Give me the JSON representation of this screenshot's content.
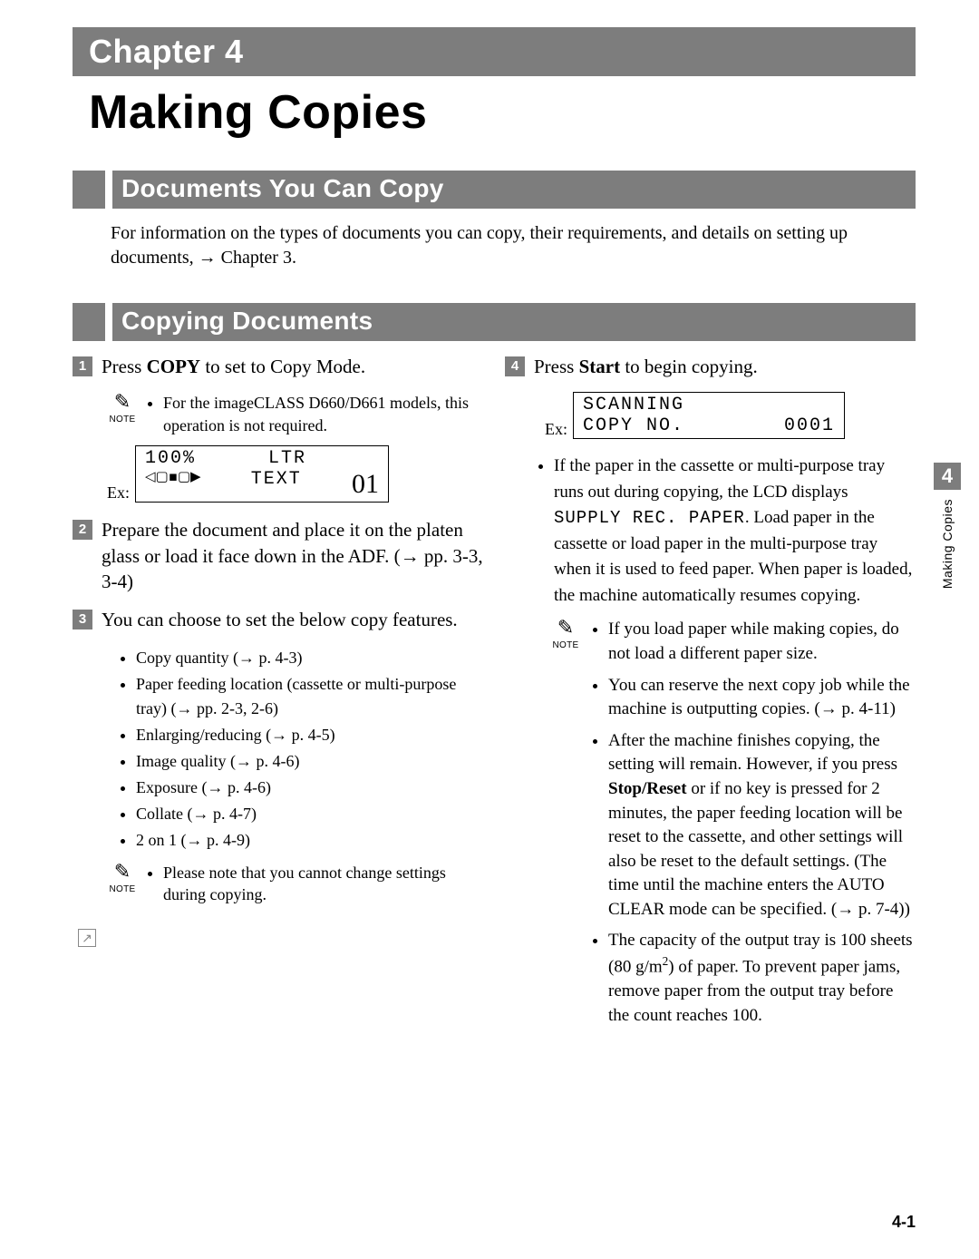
{
  "chapter": {
    "bar": "Chapter 4",
    "title": "Making Copies"
  },
  "section1": {
    "title": "Documents You Can Copy",
    "intro": "For information on the types of documents you can copy, their requirements, and details on setting up documents, → Chapter 3."
  },
  "section2": {
    "title": "Copying Documents"
  },
  "steps": {
    "s1": {
      "pre": "Press ",
      "bold": "COPY",
      "post": " to set to Copy Mode.",
      "note": "For the imageCLASS D660/D661 models, this operation is not required."
    },
    "s2": "Prepare the document and place it on the platen glass or load it face down in the ADF. (→ pp. 3-3, 3-4)",
    "s3": "You can choose to set the below copy features.",
    "s4": {
      "pre": "Press ",
      "bold": "Start",
      "post": " to begin copying."
    }
  },
  "features": [
    "Copy quantity (→ p. 4-3)",
    "Paper feeding location (cassette or multi-purpose tray) (→ pp. 2-3, 2-6)",
    "Enlarging/reducing (→ p. 4-5)",
    "Image quality (→ p. 4-6)",
    "Exposure (→ p. 4-6)",
    "Collate (→ p. 4-7)",
    "2 on 1 (→ p. 4-9)"
  ],
  "note_s3": "Please note that you cannot change settings during copying.",
  "lcd1": {
    "line1a": "100%",
    "line1b": "LTR",
    "line2a": "◁▢▪▢▶",
    "line2b": "TEXT",
    "big": "01",
    "ex": "Ex:"
  },
  "lcd2": {
    "line1": "SCANNING",
    "line2a": "COPY NO.",
    "line2b": "0001",
    "ex": "Ex:"
  },
  "s4_bullets": {
    "b1_pre": "If the paper in the cassette or multi-purpose tray runs out during copying, the LCD displays ",
    "b1_code": "SUPPLY REC. PAPER",
    "b1_post": ". Load paper in the cassette or load paper in the multi-purpose tray when it is used to feed paper. When paper is loaded, the machine automatically resumes copying."
  },
  "s4_note_items": {
    "n1": "If you load paper while making copies, do not load a different paper size.",
    "n2": "You can reserve the next copy job while the machine is outputting copies. (→ p. 4-11)",
    "n3_pre": "After the machine finishes copying, the setting will remain. However, if you press ",
    "n3_bold": "Stop/Reset",
    "n3_post": " or if no key is pressed for 2 minutes, the paper feeding location will be reset to the cassette, and other settings will also be reset to the default settings. (The time until the machine enters the AUTO CLEAR mode can be specified. (→ p. 7-4))",
    "n4_pre": "The capacity of the output tray is 100 sheets (80 g/m",
    "n4_sup": "2",
    "n4_post": ") of paper. To prevent paper jams, remove paper from the output tray before the count reaches 100."
  },
  "note_label": "NOTE",
  "side": {
    "num": "4",
    "text": "Making Copies"
  },
  "page_number": "4-1",
  "icons": {
    "pencil": "✎",
    "arrow": "↗"
  }
}
